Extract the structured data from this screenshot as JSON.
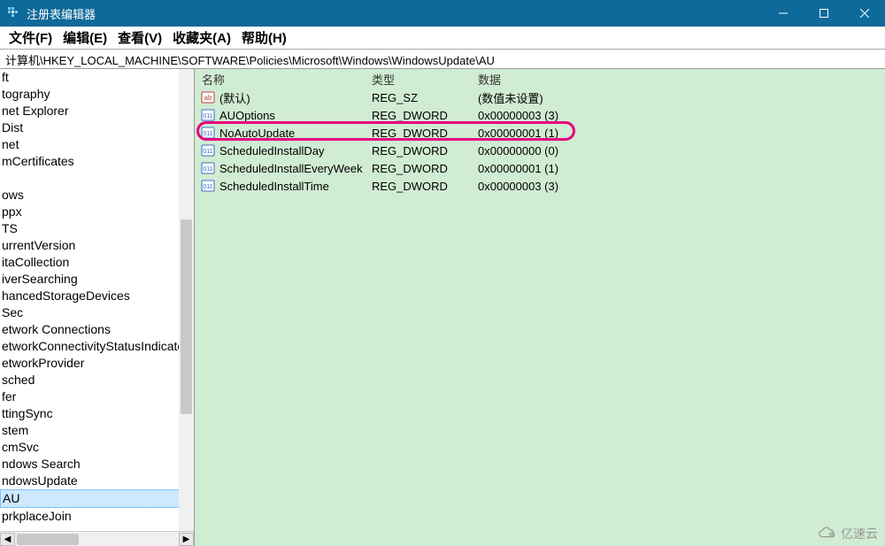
{
  "window": {
    "title": "注册表编辑器"
  },
  "menu": {
    "file": "文件(F)",
    "edit": "编辑(E)",
    "view": "查看(V)",
    "favorites": "收藏夹(A)",
    "help": "帮助(H)"
  },
  "address": "计算机\\HKEY_LOCAL_MACHINE\\SOFTWARE\\Policies\\Microsoft\\Windows\\WindowsUpdate\\AU",
  "tree": {
    "items": [
      "ft",
      "tography",
      "net Explorer",
      "Dist",
      "net",
      "mCertificates",
      "",
      "ows",
      "ppx",
      "TS",
      "urrentVersion",
      "itaCollection",
      "iverSearching",
      "hancedStorageDevices",
      "Sec",
      "etwork Connections",
      "etworkConnectivityStatusIndicator",
      "etworkProvider",
      "sched",
      "fer",
      "ttingSync",
      "stem",
      "cmSvc",
      "ndows Search",
      "ndowsUpdate",
      "AU",
      "prkplaceJoin"
    ],
    "selected_index": 25
  },
  "columns": {
    "name": "名称",
    "type": "类型",
    "data": "数据"
  },
  "values": [
    {
      "icon": "string",
      "name": "(默认)",
      "type": "REG_SZ",
      "data": "(数值未设置)"
    },
    {
      "icon": "dword",
      "name": "AUOptions",
      "type": "REG_DWORD",
      "data": "0x00000003 (3)"
    },
    {
      "icon": "dword",
      "name": "NoAutoUpdate",
      "type": "REG_DWORD",
      "data": "0x00000001 (1)",
      "highlight": true
    },
    {
      "icon": "dword",
      "name": "ScheduledInstallDay",
      "type": "REG_DWORD",
      "data": "0x00000000 (0)"
    },
    {
      "icon": "dword",
      "name": "ScheduledInstallEveryWeek",
      "type": "REG_DWORD",
      "data": "0x00000001 (1)"
    },
    {
      "icon": "dword",
      "name": "ScheduledInstallTime",
      "type": "REG_DWORD",
      "data": "0x00000003 (3)"
    }
  ],
  "watermark": "亿速云"
}
